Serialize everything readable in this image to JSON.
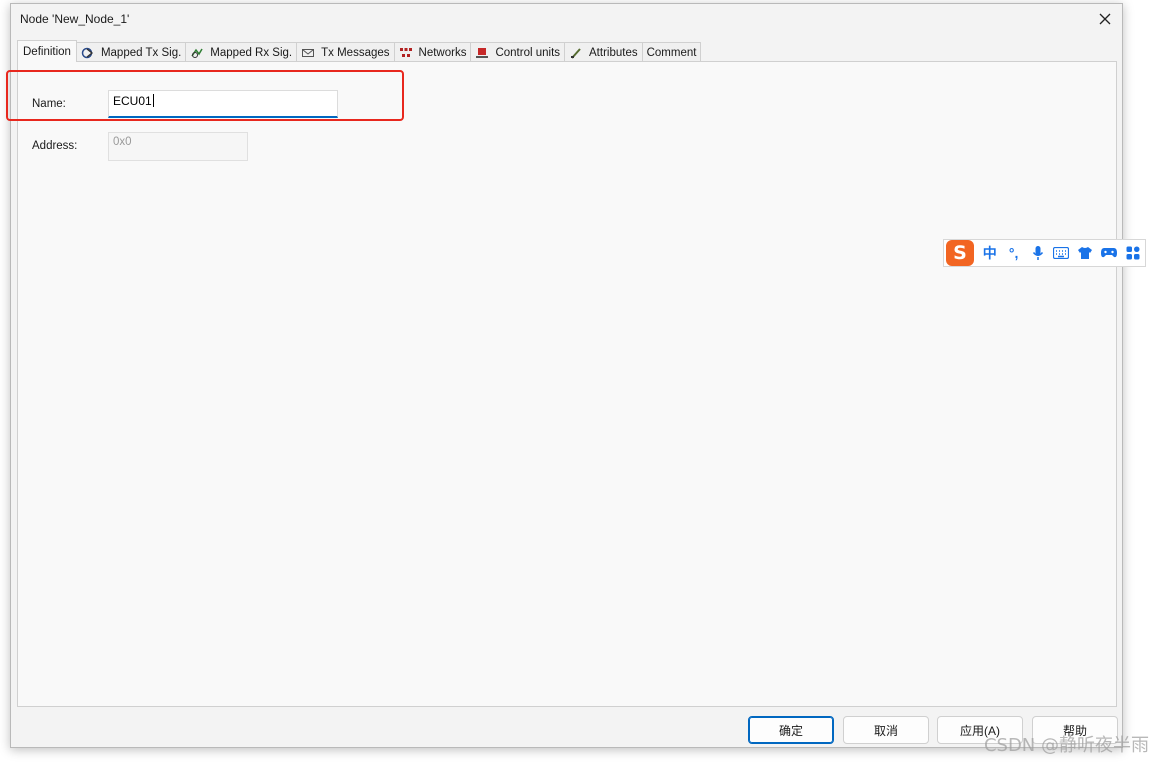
{
  "window": {
    "title": "Node 'New_Node_1'",
    "close_icon": "close-icon"
  },
  "tabs": [
    {
      "label": "Definition",
      "icon": "none",
      "active": true
    },
    {
      "label": "Mapped Tx Sig.",
      "icon": "mapped-tx-icon"
    },
    {
      "label": "Mapped Rx Sig.",
      "icon": "mapped-rx-icon"
    },
    {
      "label": "Tx Messages",
      "icon": "envelope-icon"
    },
    {
      "label": "Networks",
      "icon": "networks-icon"
    },
    {
      "label": "Control units",
      "icon": "control-unit-icon"
    },
    {
      "label": "Attributes",
      "icon": "attributes-icon"
    },
    {
      "label": "Comment",
      "icon": "none"
    }
  ],
  "form": {
    "name_label": "Name:",
    "name_value": "ECU01",
    "address_label": "Address:",
    "address_value": "0x0"
  },
  "buttons": {
    "ok": "确定",
    "cancel": "取消",
    "apply": "应用(A)",
    "help": "帮助"
  },
  "ime_toolbar": {
    "logo": "S",
    "lang": "中",
    "punct": "°,",
    "icons": [
      "microphone-icon",
      "keyboard-icon",
      "skin-icon",
      "gamepad-icon",
      "apps-icon"
    ]
  },
  "watermark": "CSDN @静听夜半雨",
  "colors": {
    "accent": "#0067c0",
    "highlight": "#e8281e",
    "ime_brand": "#f26522",
    "ime_icon": "#1a73e8"
  }
}
